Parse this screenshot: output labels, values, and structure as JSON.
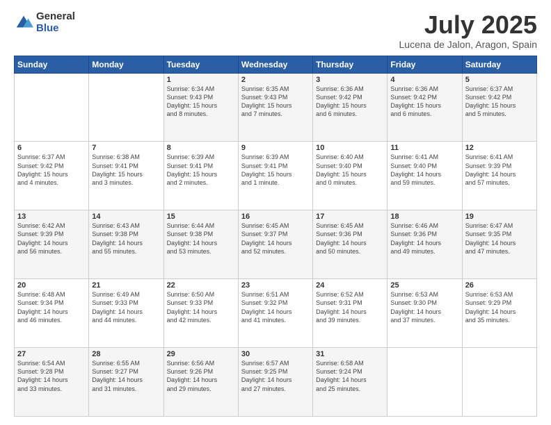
{
  "header": {
    "logo_general": "General",
    "logo_blue": "Blue",
    "title": "July 2025",
    "subtitle": "Lucena de Jalon, Aragon, Spain"
  },
  "weekdays": [
    "Sunday",
    "Monday",
    "Tuesday",
    "Wednesday",
    "Thursday",
    "Friday",
    "Saturday"
  ],
  "weeks": [
    [
      {
        "day": "",
        "info": ""
      },
      {
        "day": "",
        "info": ""
      },
      {
        "day": "1",
        "info": "Sunrise: 6:34 AM\nSunset: 9:43 PM\nDaylight: 15 hours\nand 8 minutes."
      },
      {
        "day": "2",
        "info": "Sunrise: 6:35 AM\nSunset: 9:43 PM\nDaylight: 15 hours\nand 7 minutes."
      },
      {
        "day": "3",
        "info": "Sunrise: 6:36 AM\nSunset: 9:42 PM\nDaylight: 15 hours\nand 6 minutes."
      },
      {
        "day": "4",
        "info": "Sunrise: 6:36 AM\nSunset: 9:42 PM\nDaylight: 15 hours\nand 6 minutes."
      },
      {
        "day": "5",
        "info": "Sunrise: 6:37 AM\nSunset: 9:42 PM\nDaylight: 15 hours\nand 5 minutes."
      }
    ],
    [
      {
        "day": "6",
        "info": "Sunrise: 6:37 AM\nSunset: 9:42 PM\nDaylight: 15 hours\nand 4 minutes."
      },
      {
        "day": "7",
        "info": "Sunrise: 6:38 AM\nSunset: 9:41 PM\nDaylight: 15 hours\nand 3 minutes."
      },
      {
        "day": "8",
        "info": "Sunrise: 6:39 AM\nSunset: 9:41 PM\nDaylight: 15 hours\nand 2 minutes."
      },
      {
        "day": "9",
        "info": "Sunrise: 6:39 AM\nSunset: 9:41 PM\nDaylight: 15 hours\nand 1 minute."
      },
      {
        "day": "10",
        "info": "Sunrise: 6:40 AM\nSunset: 9:40 PM\nDaylight: 15 hours\nand 0 minutes."
      },
      {
        "day": "11",
        "info": "Sunrise: 6:41 AM\nSunset: 9:40 PM\nDaylight: 14 hours\nand 59 minutes."
      },
      {
        "day": "12",
        "info": "Sunrise: 6:41 AM\nSunset: 9:39 PM\nDaylight: 14 hours\nand 57 minutes."
      }
    ],
    [
      {
        "day": "13",
        "info": "Sunrise: 6:42 AM\nSunset: 9:39 PM\nDaylight: 14 hours\nand 56 minutes."
      },
      {
        "day": "14",
        "info": "Sunrise: 6:43 AM\nSunset: 9:38 PM\nDaylight: 14 hours\nand 55 minutes."
      },
      {
        "day": "15",
        "info": "Sunrise: 6:44 AM\nSunset: 9:38 PM\nDaylight: 14 hours\nand 53 minutes."
      },
      {
        "day": "16",
        "info": "Sunrise: 6:45 AM\nSunset: 9:37 PM\nDaylight: 14 hours\nand 52 minutes."
      },
      {
        "day": "17",
        "info": "Sunrise: 6:45 AM\nSunset: 9:36 PM\nDaylight: 14 hours\nand 50 minutes."
      },
      {
        "day": "18",
        "info": "Sunrise: 6:46 AM\nSunset: 9:36 PM\nDaylight: 14 hours\nand 49 minutes."
      },
      {
        "day": "19",
        "info": "Sunrise: 6:47 AM\nSunset: 9:35 PM\nDaylight: 14 hours\nand 47 minutes."
      }
    ],
    [
      {
        "day": "20",
        "info": "Sunrise: 6:48 AM\nSunset: 9:34 PM\nDaylight: 14 hours\nand 46 minutes."
      },
      {
        "day": "21",
        "info": "Sunrise: 6:49 AM\nSunset: 9:33 PM\nDaylight: 14 hours\nand 44 minutes."
      },
      {
        "day": "22",
        "info": "Sunrise: 6:50 AM\nSunset: 9:33 PM\nDaylight: 14 hours\nand 42 minutes."
      },
      {
        "day": "23",
        "info": "Sunrise: 6:51 AM\nSunset: 9:32 PM\nDaylight: 14 hours\nand 41 minutes."
      },
      {
        "day": "24",
        "info": "Sunrise: 6:52 AM\nSunset: 9:31 PM\nDaylight: 14 hours\nand 39 minutes."
      },
      {
        "day": "25",
        "info": "Sunrise: 6:53 AM\nSunset: 9:30 PM\nDaylight: 14 hours\nand 37 minutes."
      },
      {
        "day": "26",
        "info": "Sunrise: 6:53 AM\nSunset: 9:29 PM\nDaylight: 14 hours\nand 35 minutes."
      }
    ],
    [
      {
        "day": "27",
        "info": "Sunrise: 6:54 AM\nSunset: 9:28 PM\nDaylight: 14 hours\nand 33 minutes."
      },
      {
        "day": "28",
        "info": "Sunrise: 6:55 AM\nSunset: 9:27 PM\nDaylight: 14 hours\nand 31 minutes."
      },
      {
        "day": "29",
        "info": "Sunrise: 6:56 AM\nSunset: 9:26 PM\nDaylight: 14 hours\nand 29 minutes."
      },
      {
        "day": "30",
        "info": "Sunrise: 6:57 AM\nSunset: 9:25 PM\nDaylight: 14 hours\nand 27 minutes."
      },
      {
        "day": "31",
        "info": "Sunrise: 6:58 AM\nSunset: 9:24 PM\nDaylight: 14 hours\nand 25 minutes."
      },
      {
        "day": "",
        "info": ""
      },
      {
        "day": "",
        "info": ""
      }
    ]
  ]
}
